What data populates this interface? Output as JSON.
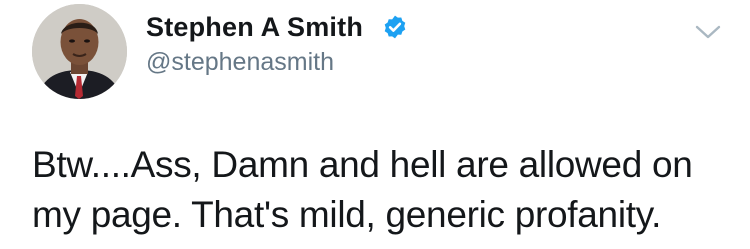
{
  "author": {
    "display_name": "Stephen A Smith",
    "handle": "@stephenasmith",
    "verified": true,
    "avatar_icon": "profile-photo"
  },
  "tweet": {
    "lines": [
      "Btw....Ass, Damn and hell are allowed on",
      "my page. That's mild, generic profanity."
    ]
  },
  "menu": {
    "icon": "chevron-down-icon"
  },
  "colors": {
    "verified_blue": "#1da1f2",
    "handle_gray": "#657786",
    "text": "#14171a",
    "chevron": "#aab8c2"
  }
}
